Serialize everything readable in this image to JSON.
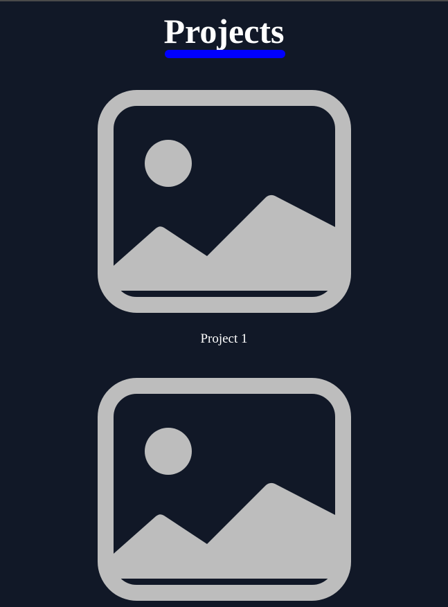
{
  "page": {
    "title": "Projects"
  },
  "colors": {
    "background": "#111827",
    "accent": "#0000ff",
    "placeholder": "#bdbdbd"
  },
  "projects": [
    {
      "name": "Project 1",
      "icon": "image-placeholder-icon"
    },
    {
      "name": "",
      "icon": "image-placeholder-icon"
    }
  ]
}
